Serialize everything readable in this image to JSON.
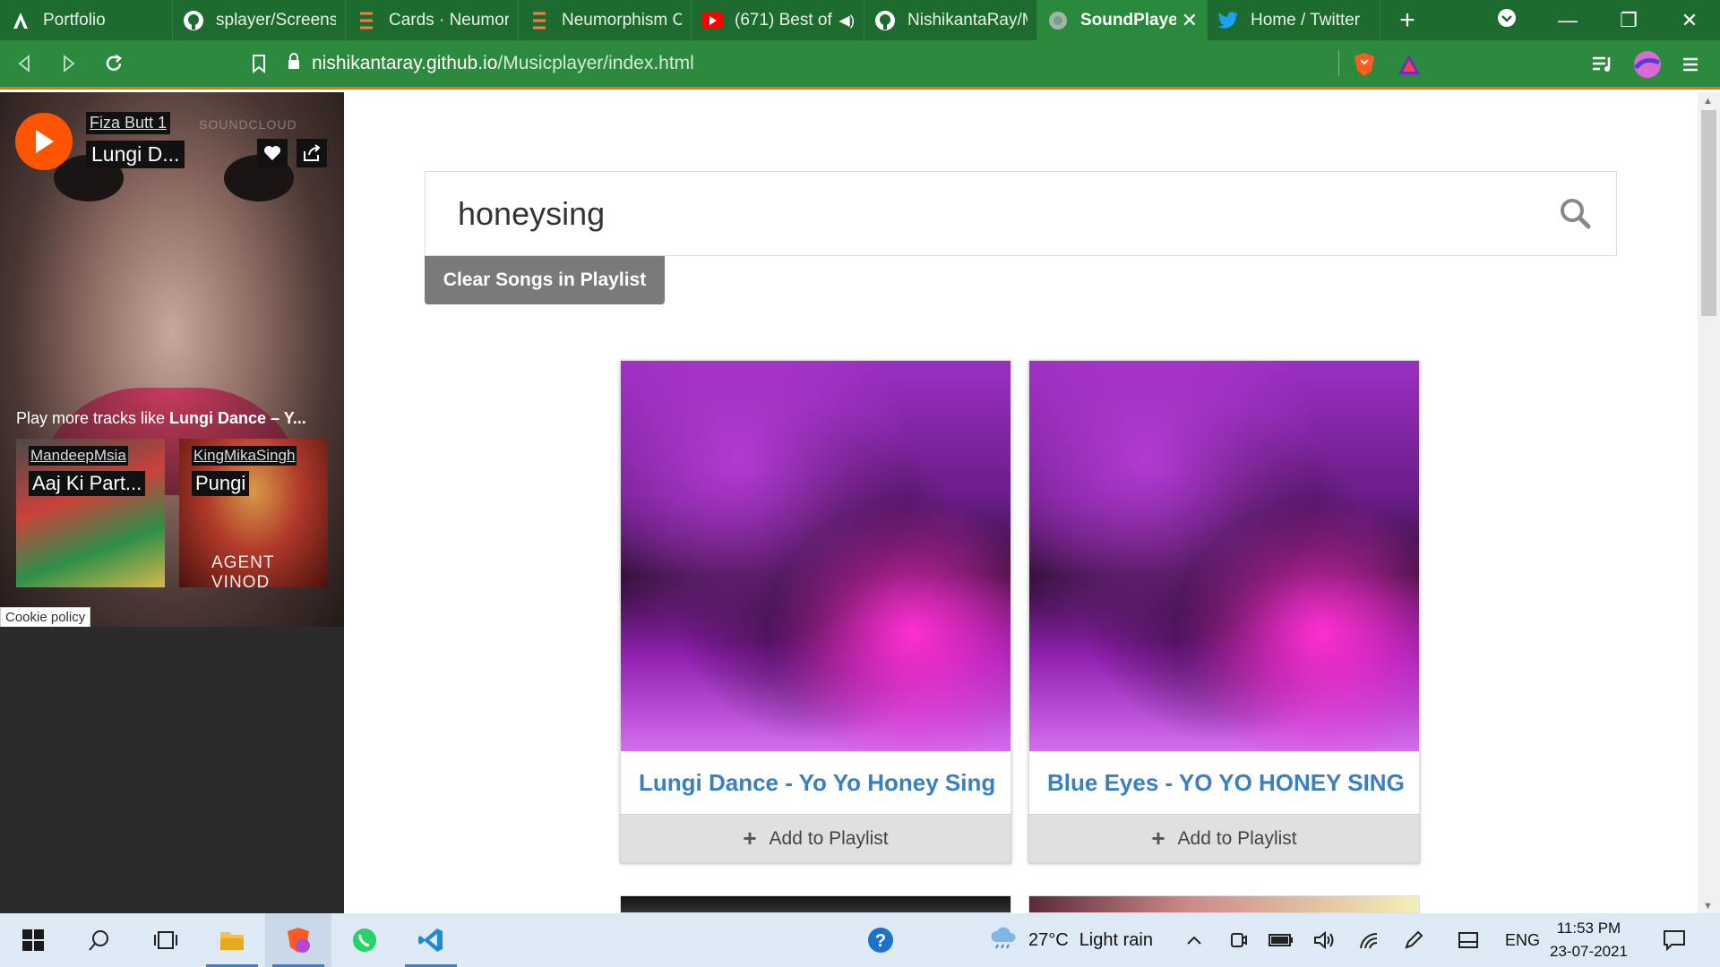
{
  "browser": {
    "tabs": [
      {
        "title": "Portfolio",
        "icon": "a-logo-icon",
        "active": false
      },
      {
        "title": "splayer/Screensh",
        "icon": "github-icon",
        "active": false
      },
      {
        "title": "Cards · Neumorp",
        "icon": "tripletex-icon",
        "active": false
      },
      {
        "title": "Neumorphism Cc",
        "icon": "tripletex-icon",
        "active": false
      },
      {
        "title": "(671) Best of",
        "icon": "youtube-icon",
        "active": false
      },
      {
        "title": "NishikantaRay/M",
        "icon": "github-icon",
        "active": false
      },
      {
        "title": "SoundPlayer",
        "icon": "globe-icon",
        "active": true
      },
      {
        "title": "Home / Twitter",
        "icon": "twitter-icon",
        "active": false
      }
    ],
    "new_tab": "+",
    "url_host": "nishikantaray.github.io",
    "url_path": "/Musicplayer/index.html",
    "colors": {
      "chrome": "#1d6b2e",
      "active_tab": "#2a8a3c",
      "accent": "#ff6a00"
    }
  },
  "soundcloud_widget": {
    "user": "Fiza Butt 1",
    "track_title": "Lungi D...",
    "brand": "SOUNDCLOUD",
    "more_prefix": "Play more tracks like ",
    "more_track": "Lungi Dance – Y...",
    "related": [
      {
        "user": "MandeepMsia",
        "title": "Aaj Ki Part..."
      },
      {
        "user": "KingMikaSingh",
        "title": "Pungi",
        "art_text": "AGENT VINOD"
      }
    ],
    "cookie_policy": "Cookie policy",
    "play_color": "#ff5500"
  },
  "main": {
    "search_value": "honeysing",
    "clear_button": "Clear Songs in Playlist",
    "cards": [
      {
        "title": "Lungi Dance - Yo Yo Honey Sing",
        "add_label": "Add to Playlist"
      },
      {
        "title": "Blue Eyes - YO YO HONEY SING",
        "add_label": "Add to Playlist"
      }
    ],
    "link_color": "#3a7fc1"
  },
  "taskbar": {
    "weather_temp": "27°C",
    "weather_text": "Light rain",
    "language": "ENG",
    "time": "11:53 PM",
    "date": "23-07-2021"
  }
}
